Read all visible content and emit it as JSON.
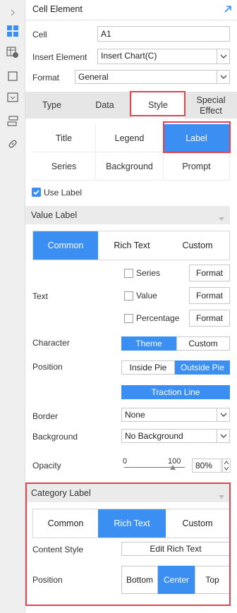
{
  "panel_title": "Cell Element",
  "cell": {
    "label": "Cell",
    "value": "A1"
  },
  "insert_element": {
    "label": "Insert Element",
    "value": "Insert Chart(C)"
  },
  "format": {
    "label": "Format",
    "value": "General"
  },
  "tabs": [
    "Type",
    "Data",
    "Style",
    "Special Effect"
  ],
  "style_buttons": [
    "Title",
    "Legend",
    "Label",
    "Series",
    "Background",
    "Prompt"
  ],
  "use_label": "Use Label",
  "value_label": {
    "header": "Value Label",
    "modes": [
      "Common",
      "Rich Text",
      "Custom"
    ],
    "text_label": "Text",
    "items": [
      {
        "name": "Series",
        "button": "Format"
      },
      {
        "name": "Value",
        "button": "Format"
      },
      {
        "name": "Percentage",
        "button": "Format"
      }
    ],
    "character_label": "Character",
    "character_options": [
      "Theme",
      "Custom"
    ],
    "position_label": "Position",
    "position_options": [
      "Inside Pie",
      "Outside Pie"
    ],
    "traction_line": "Traction Line",
    "border_label": "Border",
    "border_value": "None",
    "background_label": "Background",
    "background_value": "No Background",
    "opacity_label": "Opacity",
    "opacity_min": "0",
    "opacity_max": "100",
    "opacity_value": "80%",
    "opacity_level": 0.8
  },
  "category_label": {
    "header": "Category Label",
    "modes": [
      "Common",
      "Rich Text",
      "Custom"
    ],
    "content_style_label": "Content Style",
    "content_style_button": "Edit Rich Text",
    "position_label": "Position",
    "position_options": [
      "Bottom",
      "Center",
      "Top"
    ]
  },
  "colors": {
    "accent": "#3b8ff2",
    "highlight": "#e0454f"
  }
}
